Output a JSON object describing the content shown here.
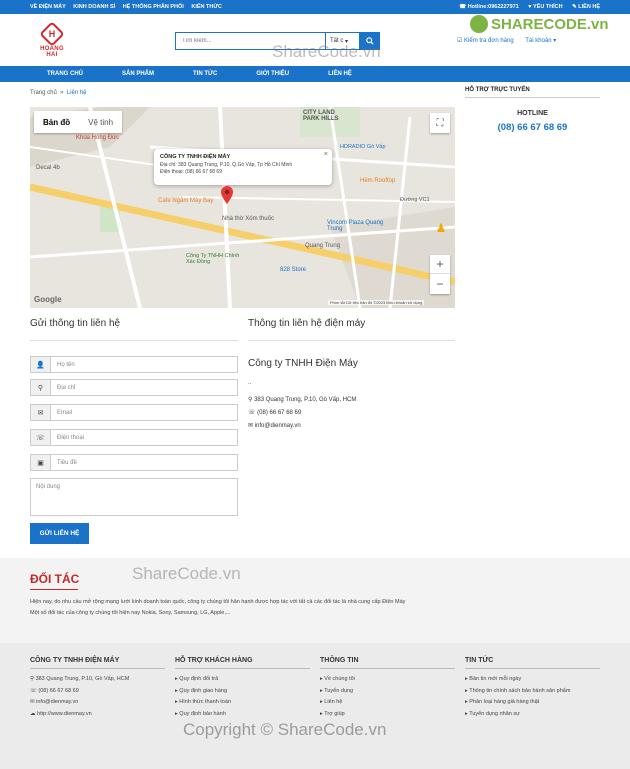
{
  "topbar": {
    "left": [
      "VỀ ĐIỆN MÁY",
      "KINH DOANH SỈ",
      "HỆ THỐNG PHÂN PHỐI",
      "KIẾN THỨC"
    ],
    "hotline": "Hotline:0962227971",
    "favorites": "YÊU THÍCH",
    "contact": "LIÊN HỆ"
  },
  "logo": {
    "mark": "H",
    "name": "HOANG HAI"
  },
  "search": {
    "placeholder": "Tìm kiếm...",
    "category": "Tất c"
  },
  "header_links": {
    "order_check": "Kiểm tra đơn hàng",
    "account": "Tài khoản"
  },
  "nav": [
    "TRANG CHỦ",
    "SẢN PHẨM",
    "TIN TỨC",
    "GIỚI THIỆU",
    "LIÊN HỆ"
  ],
  "breadcrumb": {
    "home": "Trang chủ",
    "sep": "»",
    "current": "Liên hệ"
  },
  "map": {
    "tabs": [
      "Bản đồ",
      "Vệ tinh"
    ],
    "popup": {
      "title": "CÔNG TY TNHH ĐIỆN MÁY",
      "address": "Địa chỉ: 383 Quang Trung, P.10, Q.Gò Vấp, Tp Hồ Chí Minh",
      "phone": "Điện thoại: (08) 66 67 68 69"
    },
    "places": [
      "CITY LAND PARK HILLS",
      "Khoa Hồng Đức",
      "HDRADIO Gò Vấp",
      "Decal 4b",
      "Cafe Ngắm Mây Bay",
      "Nhà thờ Xóm thuốc",
      "Vincom Plaza Quang Trung",
      "Quang Trung",
      "Công Ty TNHH Chính Xác Đồng",
      "828 Store",
      "Hẻm Rooftop",
      "Đường VC1"
    ],
    "google": "Google",
    "footer_text": "Phím tắt   Dữ liệu bản đồ ©2023   Điều khoản sử dụng"
  },
  "support": {
    "title": "HỖ TRỢ TRỰC TUYẾN",
    "hotline_label": "HOTLINE",
    "hotline": "(08) 66 67 68 69"
  },
  "form": {
    "title": "Gửi thông tin liên hệ",
    "fields": [
      "Họ tên",
      "Địa chỉ",
      "Email",
      "Điện thoại",
      "Tiêu đề"
    ],
    "content": "Nội dung",
    "submit": "GỬI LIÊN HỆ"
  },
  "info": {
    "title": "Thông tin liên hệ điện máy",
    "company": "Công ty TNHH Điện Máy",
    "dots": "..",
    "address": "383 Quang Trung, P.10, Gò Vấp, HCM",
    "phone": "(08) 66 67 68 69",
    "email": "info@dienmay.vn"
  },
  "partners": {
    "title": "ĐỐI TÁC",
    "line1": "Hiện nay, do nhu cầu mở rộng mạng lưới kinh doanh toàn quốc, công ty chúng tôi hân hạnh được hợp tác với tất cả các đối tác là nhà cung cấp Điện Máy",
    "line2": "Một số đối tác của công ty chúng tôi hiện nay Nokia, Sony, Samsung, LG, Apple,..."
  },
  "footer": {
    "cols": [
      {
        "title": "CÔNG TY TNHH ĐIỆN MÁY",
        "items": [
          "383 Quang Trung, P.10, Gò Vấp, HCM",
          "(08) 66 67 68 69",
          "info@dienmay.vn",
          "http://www.dienmay.vn"
        ]
      },
      {
        "title": "HỖ TRỢ KHÁCH HÀNG",
        "items": [
          "Quy định đổi trả",
          "Quy định giao hàng",
          "Hình thức thanh toán",
          "Quy định bảo hành"
        ]
      },
      {
        "title": "THÔNG TIN",
        "items": [
          "Về chúng tôi",
          "Tuyển dụng",
          "Liên hệ",
          "Trợ giúp"
        ]
      },
      {
        "title": "TIN TỨC",
        "items": [
          "Bản tin mới mỗi ngày",
          "Thông tin chính sách bảo hành sản phẩm",
          "Phân loại hàng giả hàng thật",
          "Tuyển dụng nhân sự"
        ]
      }
    ]
  },
  "watermark": {
    "brand": "SHARECODE.vn",
    "mid": "ShareCode.vn",
    "bottom": "Copyright © ShareCode.vn"
  }
}
